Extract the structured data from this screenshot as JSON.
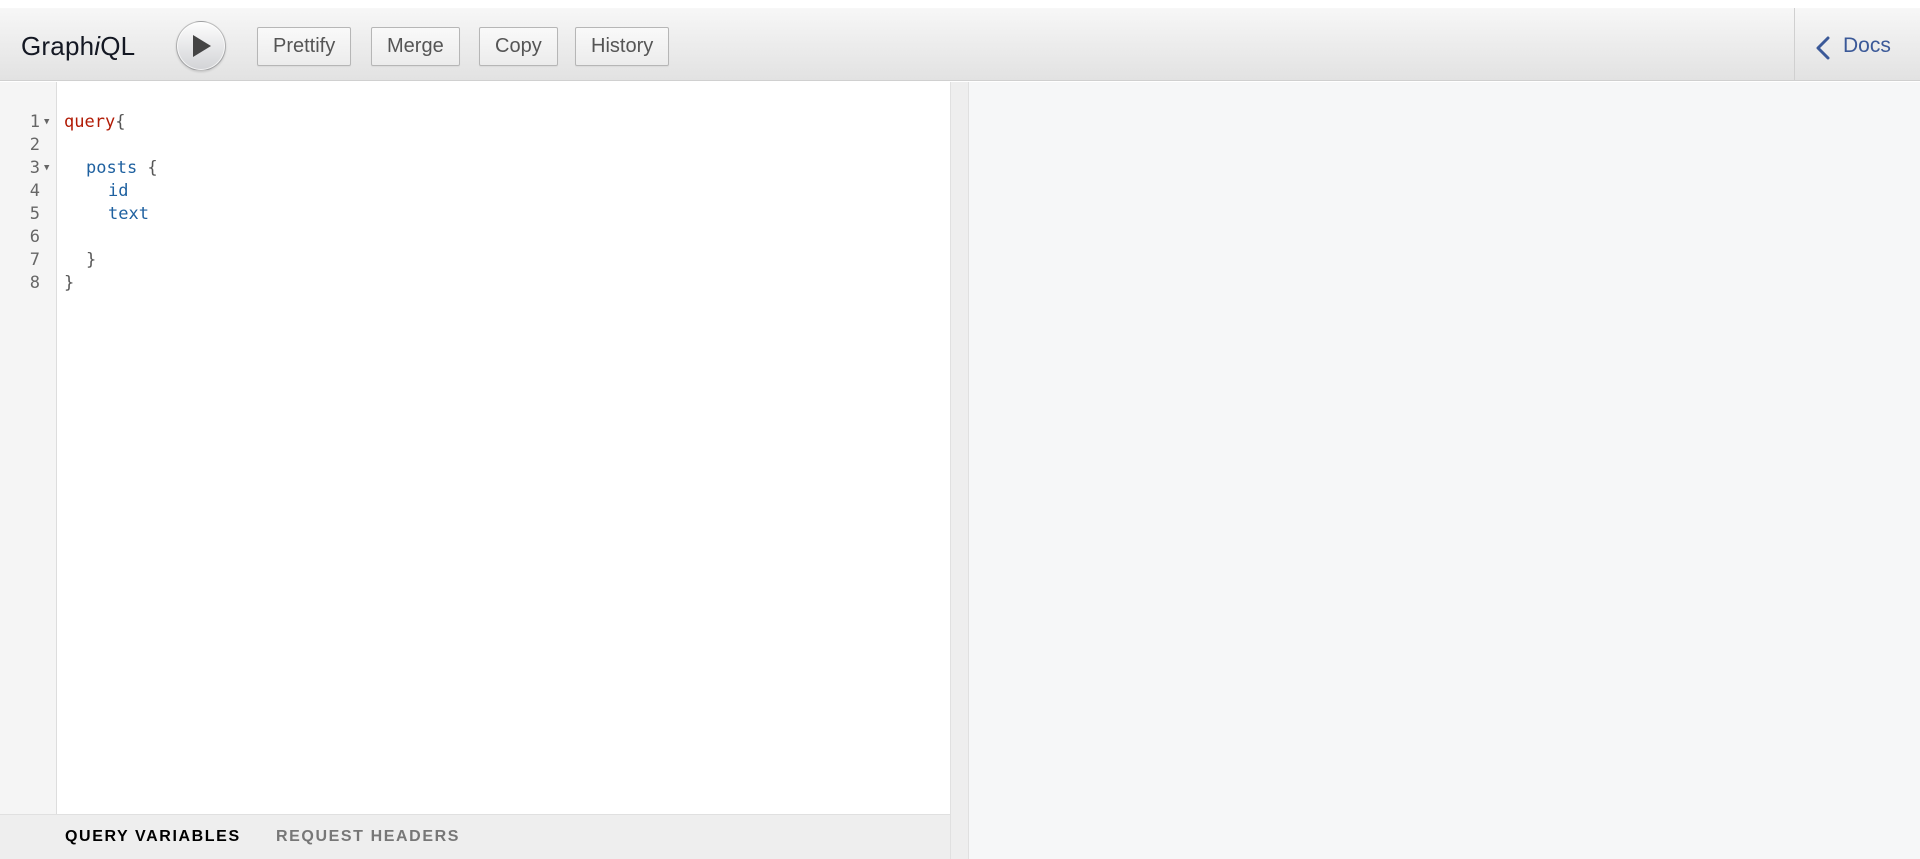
{
  "header": {
    "title_prefix": "Graph",
    "title_italic": "i",
    "title_suffix": "QL",
    "buttons": {
      "prettify": "Prettify",
      "merge": "Merge",
      "copy": "Copy",
      "history": "History"
    },
    "docs_label": "Docs"
  },
  "editor": {
    "lines": [
      {
        "num": "1",
        "foldable": true
      },
      {
        "num": "2",
        "foldable": false
      },
      {
        "num": "3",
        "foldable": true
      },
      {
        "num": "4",
        "foldable": false
      },
      {
        "num": "5",
        "foldable": false
      },
      {
        "num": "6",
        "foldable": false
      },
      {
        "num": "7",
        "foldable": false
      },
      {
        "num": "8",
        "foldable": false
      }
    ],
    "tokens": {
      "query_keyword": "query",
      "open_brace": "{",
      "posts_field": "posts",
      "posts_open_brace": " {",
      "id_field": "id",
      "text_field": "text",
      "posts_close_brace": "}",
      "close_brace": "}"
    }
  },
  "variables_bar": {
    "query_variables_tab": "QUERY VARIABLES",
    "request_headers_tab": "REQUEST HEADERS"
  },
  "colors": {
    "keyword": "#b11a04",
    "field": "#1f61a0",
    "docs_link": "#3b5998"
  }
}
